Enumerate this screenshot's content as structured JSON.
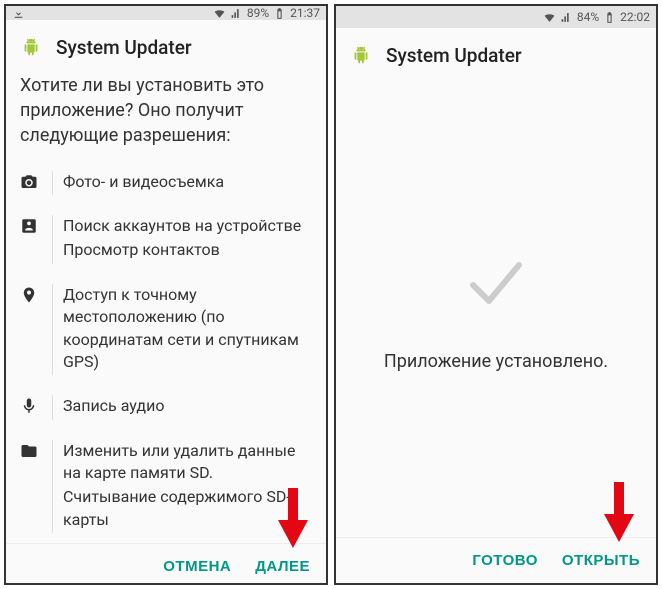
{
  "left": {
    "statusbar": {
      "battery": "89%",
      "time": "21:37"
    },
    "header": {
      "title": "System Updater"
    },
    "prompt": "Хотите ли вы установить это приложение? Оно получит следующие разрешения:",
    "permissions": [
      {
        "icon": "camera",
        "lines": [
          "Фото- и видеосъемка"
        ]
      },
      {
        "icon": "contacts",
        "lines": [
          "Поиск аккаунтов на устройстве",
          "Просмотр контактов"
        ]
      },
      {
        "icon": "location",
        "lines": [
          "Доступ к точному местоположению (по координатам сети и спутникам GPS)"
        ]
      },
      {
        "icon": "mic",
        "lines": [
          "Запись аудио"
        ]
      },
      {
        "icon": "folder",
        "lines": [
          "Изменить или удалить данные на карте памяти SD.",
          "Считывание содержимого SD-карты"
        ]
      }
    ],
    "footer": {
      "cancel": "ОТМЕНА",
      "next": "ДАЛЕЕ"
    }
  },
  "right": {
    "statusbar": {
      "battery": "84%",
      "time": "22:02"
    },
    "header": {
      "title": "System Updater"
    },
    "installed_text": "Приложение установлено.",
    "footer": {
      "done": "ГОТОВО",
      "open": "ОТКРЫТЬ"
    }
  },
  "colors": {
    "accent": "#009688",
    "arrow": "#e30613"
  }
}
